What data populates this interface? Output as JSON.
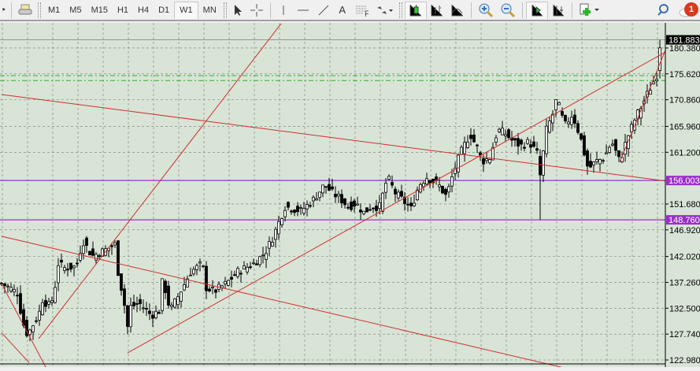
{
  "toolbar": {
    "timeframes": [
      "M1",
      "M5",
      "M15",
      "H1",
      "H4",
      "D1",
      "W1",
      "MN"
    ],
    "active_timeframe": "W1",
    "text_tool": "A",
    "notifications": "1"
  },
  "colors": {
    "background": "#d8e4d6",
    "grid": "#7a7a7a",
    "trendline": "#d03030",
    "level": "#9b30c8",
    "target": "#30b030",
    "bull": "#ffffff",
    "bear": "#000000"
  },
  "chart_data": {
    "type": "candlestick",
    "timeframe": "W1",
    "ylim": [
      122.2,
      184.0
    ],
    "price_ticks": [
      180.38,
      175.62,
      170.86,
      165.96,
      161.2,
      151.68,
      146.92,
      142.02,
      137.26,
      132.5,
      127.74,
      122.98
    ],
    "current_price": "181.883",
    "levels": [
      {
        "price": 156.003,
        "label": "156.003"
      },
      {
        "price": 148.76,
        "label": "148.760"
      }
    ],
    "target_levels": [
      175.3,
      174.4
    ],
    "close_path": [
      [
        0,
        137.0
      ],
      [
        2.5,
        136.3
      ],
      [
        5,
        135.3
      ],
      [
        6.75,
        129.8
      ],
      [
        8.25,
        127.6
      ],
      [
        10,
        129.5
      ],
      [
        11.75,
        131.2
      ],
      [
        13,
        134.1
      ],
      [
        15.5,
        132.7
      ],
      [
        17,
        136.7
      ],
      [
        18,
        140.7
      ],
      [
        20,
        139.9
      ],
      [
        23.75,
        140.2
      ],
      [
        25.75,
        145.0
      ],
      [
        28.75,
        142.1
      ],
      [
        32.5,
        143.1
      ],
      [
        36.25,
        144.3
      ],
      [
        37,
        139.2
      ],
      [
        38.75,
        134.1
      ],
      [
        40,
        129.1
      ],
      [
        40.75,
        132.7
      ],
      [
        43.75,
        133.4
      ],
      [
        47.5,
        131.2
      ],
      [
        50,
        132.0
      ],
      [
        51.25,
        138.5
      ],
      [
        52.5,
        134.1
      ],
      [
        53.75,
        132.3
      ],
      [
        56.25,
        134.9
      ],
      [
        60,
        139.2
      ],
      [
        63.75,
        140.7
      ],
      [
        65,
        136.3
      ],
      [
        67.5,
        135.6
      ],
      [
        71.25,
        137.0
      ],
      [
        75,
        139.2
      ],
      [
        80,
        140.7
      ],
      [
        83.75,
        142.8
      ],
      [
        86.25,
        145.7
      ],
      [
        88.75,
        149.4
      ],
      [
        90,
        151.2
      ],
      [
        92.5,
        150.8
      ],
      [
        95,
        150.4
      ],
      [
        98.75,
        152.3
      ],
      [
        102.5,
        155.2
      ],
      [
        105,
        153.7
      ],
      [
        107.5,
        152.7
      ],
      [
        110,
        151.2
      ],
      [
        112.5,
        151.8
      ],
      [
        115,
        150.1
      ],
      [
        117.5,
        151.2
      ],
      [
        120,
        151.2
      ],
      [
        122.5,
        156.6
      ],
      [
        125,
        153.7
      ],
      [
        127.5,
        152.3
      ],
      [
        130,
        150.8
      ],
      [
        132.5,
        155.2
      ],
      [
        135,
        156.6
      ],
      [
        138.75,
        155.2
      ],
      [
        141.25,
        153.0
      ],
      [
        143.75,
        158.1
      ],
      [
        146.25,
        161.7
      ],
      [
        148.75,
        164.6
      ],
      [
        151.25,
        161.7
      ],
      [
        152.5,
        159.5
      ],
      [
        155,
        160.2
      ],
      [
        157.5,
        165.3
      ],
      [
        160,
        164.6
      ],
      [
        162.5,
        163.1
      ],
      [
        165,
        162.4
      ],
      [
        167.5,
        163.1
      ],
      [
        170,
        161.0
      ],
      [
        171.25,
        155.9
      ],
      [
        172.5,
        164.6
      ],
      [
        175,
        168.2
      ],
      [
        176.25,
        171.1
      ],
      [
        178.75,
        166.0
      ],
      [
        181.25,
        168.2
      ],
      [
        183.75,
        164.0
      ],
      [
        186.25,
        158.1
      ],
      [
        188.75,
        159.5
      ],
      [
        191.25,
        160.2
      ],
      [
        193.75,
        163.1
      ],
      [
        196.25,
        159.5
      ],
      [
        198.75,
        164.0
      ],
      [
        201.25,
        167.5
      ],
      [
        203.75,
        170.4
      ],
      [
        206.25,
        173.3
      ],
      [
        208,
        175.4
      ],
      [
        209,
        180.9
      ]
    ],
    "trendlines": [
      [
        [
          0,
          171.82
        ],
        [
          211.25,
          155.88
        ]
      ],
      [
        [
          11.75,
          126.89
        ],
        [
          88.75,
          184.86
        ]
      ],
      [
        [
          40,
          124.28
        ],
        [
          211.25,
          179.79
        ]
      ],
      [
        [
          0,
          145.73
        ],
        [
          185,
          120.66
        ]
      ],
      [
        [
          0,
          137.0
        ],
        [
          15,
          120.6
        ]
      ],
      [
        [
          0,
          127.99
        ],
        [
          8.75,
          122.48
        ]
      ],
      [
        [
          196.25,
          159.37
        ],
        [
          211.25,
          180.67
        ]
      ]
    ]
  }
}
